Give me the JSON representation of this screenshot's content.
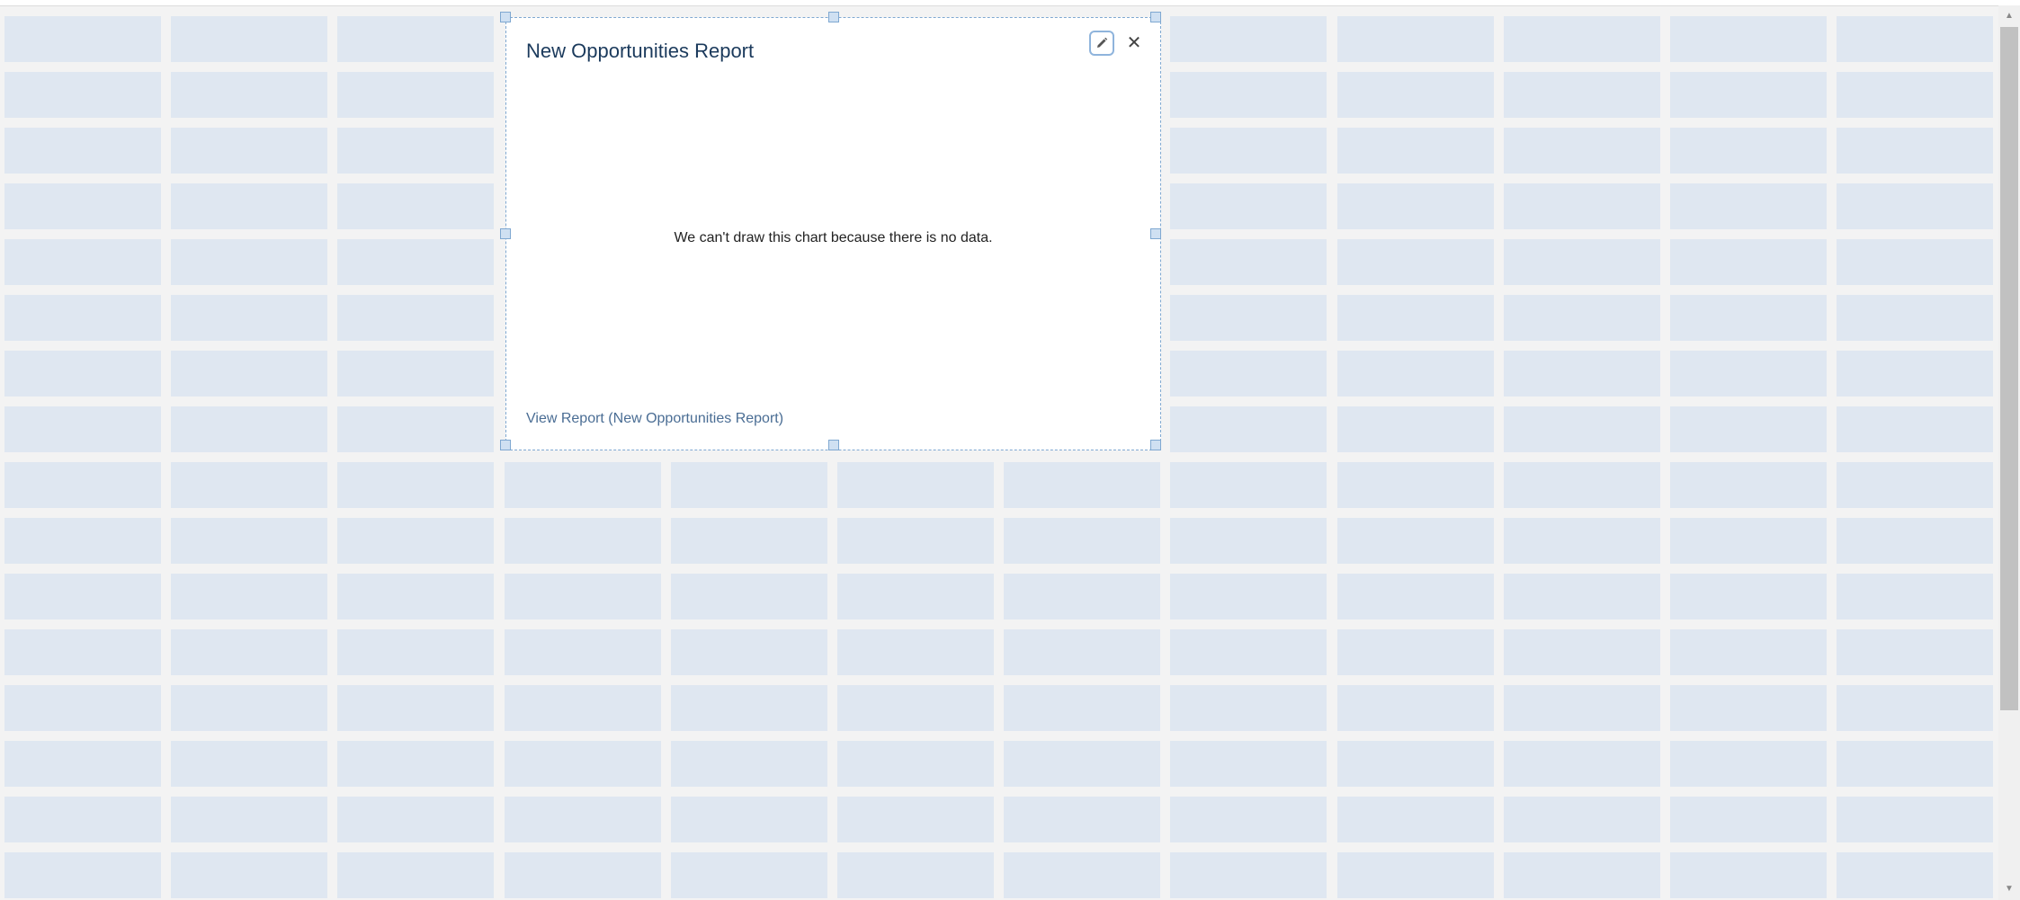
{
  "widget": {
    "title": "New Opportunities Report",
    "message": "We can't draw this chart because there is no data.",
    "link_label": "View Report (New Opportunities Report)",
    "edit_icon": "pencil-icon",
    "close_glyph": "✕"
  },
  "scrollbar": {
    "up_glyph": "▲",
    "down_glyph": "▼"
  },
  "colors": {
    "background": "#f3f3f3",
    "grid_cell": "#dfe7f1",
    "widget_border": "#7fa8d1",
    "title": "#1b3a5c",
    "link": "#4a6d94"
  }
}
